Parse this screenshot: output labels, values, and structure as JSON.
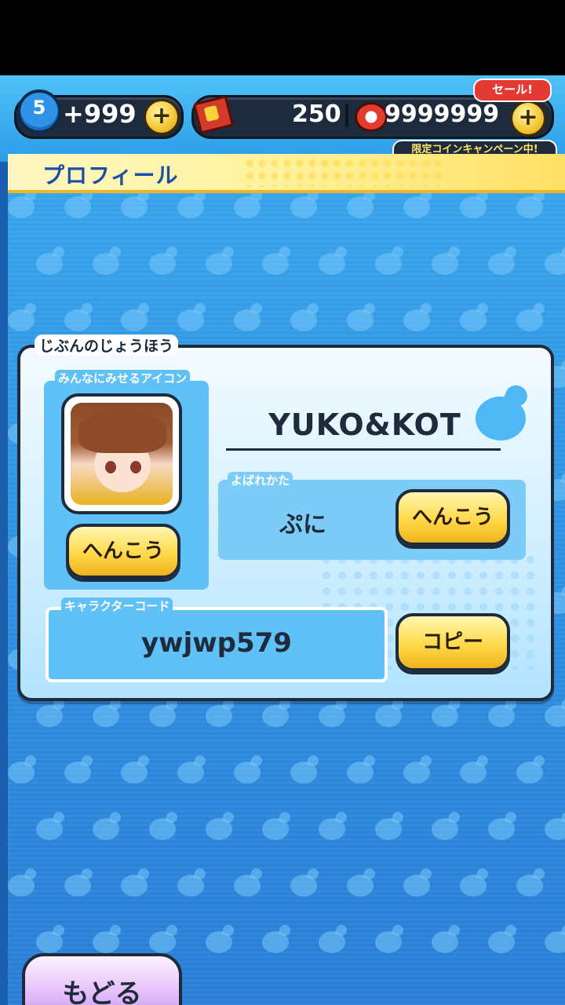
{
  "status_bar": {
    "stamina_level": "5",
    "stamina_bonus": "+999",
    "tickets": "250",
    "coins": "9999999",
    "plus_label": "+",
    "sale_badge": "セール!",
    "campaign_text": "限定コインキャンペーン中!"
  },
  "header": {
    "title": "プロフィール"
  },
  "profile": {
    "section_title": "じぶんのじょうほう",
    "icon_label": "みんなにみせるアイコン",
    "icon_change_button": "へんこう",
    "player_name": "YUKO&KOT",
    "call_label": "よばれかた",
    "call_value": "ぷに",
    "call_change_button": "へんこう",
    "code_label": "キャラクターコード",
    "code_value": "ywjwp579",
    "copy_button": "コピー"
  },
  "footer": {
    "back_button": "もどる"
  },
  "colors": {
    "background_blue": "#2f8fe0",
    "button_yellow": "#ffd94a",
    "title_text_blue": "#1b4fa6",
    "back_button_purple": "#c08cf0"
  }
}
